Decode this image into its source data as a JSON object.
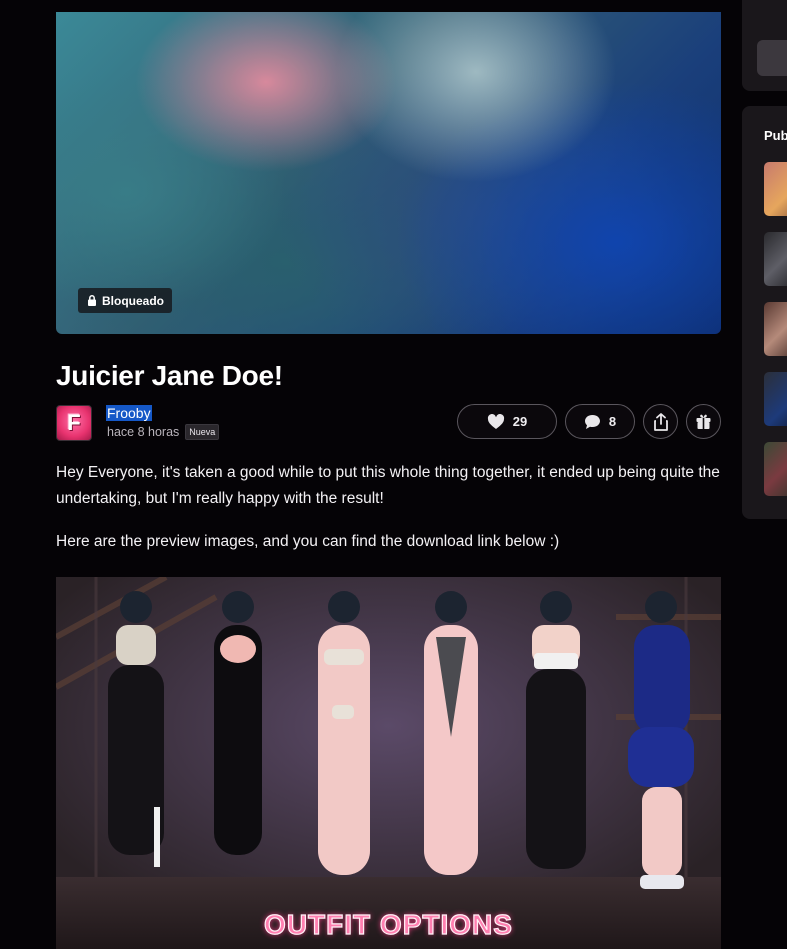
{
  "post": {
    "locked_label": "Bloqueado",
    "title": "Juicier Jane Doe!",
    "author": "Frooby",
    "avatar_letter": "F",
    "time": "hace 8 horas",
    "new_badge": "Nueva",
    "likes": "29",
    "comments": "8",
    "paragraphs": [
      "Hey Everyone, it's taken a good while to put this whole thing together, it ended up being quite the undertaking, but I'm really happy with the result!",
      "Here are the preview images, and you can find the download link below :)"
    ],
    "preview_caption": "OUTFIT OPTIONS"
  },
  "sidebar": {
    "heading": "Pub"
  },
  "colors": {
    "background": "#050306",
    "accent_selection": "#1558c7",
    "avatar": "#e8336f",
    "caption": "#ff7fb0"
  },
  "icons": [
    "lock-icon",
    "heart-icon",
    "comment-icon",
    "share-icon",
    "gift-icon"
  ]
}
